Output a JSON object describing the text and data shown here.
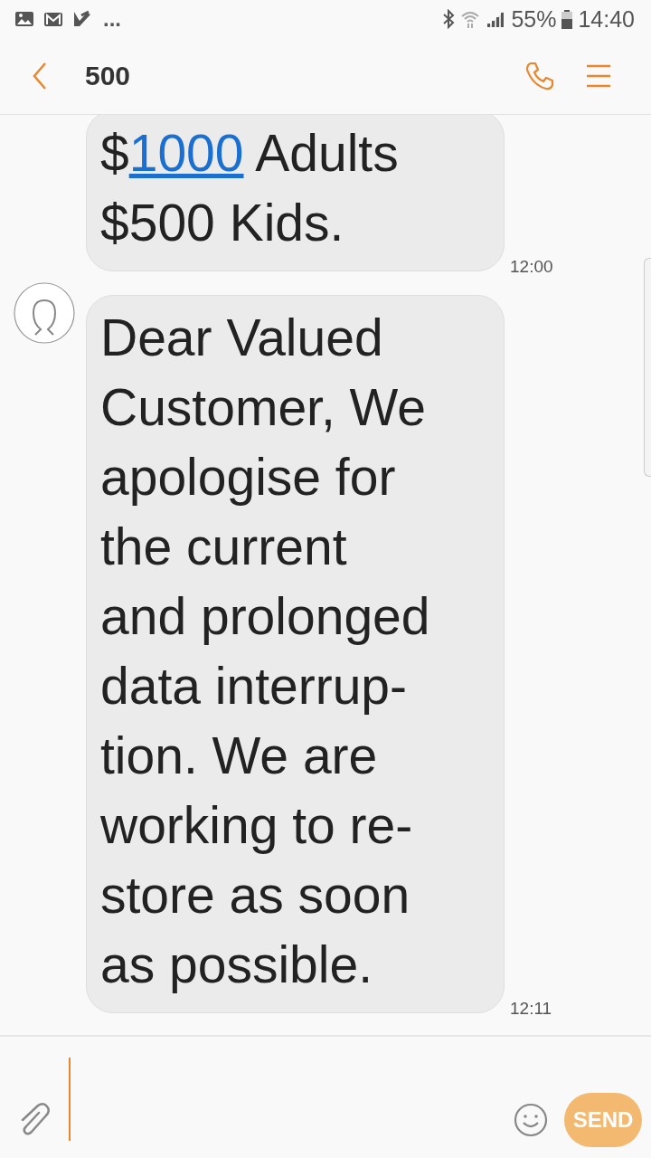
{
  "status_bar": {
    "notifications": "...",
    "battery": "55%",
    "time": "14:40"
  },
  "header": {
    "title": "500"
  },
  "messages": [
    {
      "avatar": false,
      "time": "12:00",
      "lines": [
        [
          {
            "text": "$"
          },
          {
            "text": "1000",
            "kind": "link"
          },
          {
            "text": " Adults"
          }
        ],
        [
          {
            "text": "$500 Kids."
          }
        ]
      ]
    },
    {
      "avatar": true,
      "time": "12:11",
      "lines": [
        [
          {
            "text": "Dear Valued"
          }
        ],
        [
          {
            "text": "Customer, We"
          }
        ],
        [
          {
            "text": "apologise for"
          }
        ],
        [
          {
            "text": "the current"
          }
        ],
        [
          {
            "text": "and prolonged"
          }
        ],
        [
          {
            "text": "data interrup-"
          }
        ],
        [
          {
            "text": "tion. We are"
          }
        ],
        [
          {
            "text": "working to re-"
          }
        ],
        [
          {
            "text": "store as soon"
          }
        ],
        [
          {
            "text": "as possible."
          }
        ]
      ]
    }
  ],
  "composer": {
    "send": {
      "label": "SEND",
      "disabled": true
    }
  }
}
